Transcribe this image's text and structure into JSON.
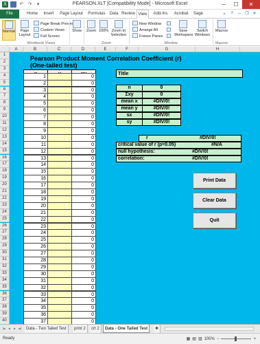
{
  "window": {
    "title": "PEARSON.XLT  [Compatibility Mode]  -  Microsoft Excel"
  },
  "tabs": [
    "File",
    "Home",
    "Insert",
    "Page Layout",
    "Formulas",
    "Data",
    "Review",
    "View",
    "Add-Ins",
    "Acrobat",
    "Sage"
  ],
  "active_tab": "View",
  "ribbon": {
    "normal": "Normal",
    "page_layout": "Page Layout",
    "page_break_preview": "Page Break Preview",
    "custom_views": "Custom Views",
    "full_screen": "Full Screen",
    "workbook_views_group": "Workbook Views",
    "show": "Show",
    "zoom": "Zoom",
    "zoom_100": "100%",
    "zoom_to_selection": "Zoom to Selection",
    "zoom_group": "Zoom",
    "new_window": "New Window",
    "arrange_all": "Arrange All",
    "freeze_panes": "Freeze Panes",
    "save_workspace": "Save Workspace",
    "switch_windows": "Switch Windows",
    "window_group": "Window",
    "macros": "Macros",
    "macros_group": "Macros"
  },
  "columns": [
    "A",
    "B",
    "C",
    "D",
    "E",
    "F",
    "G",
    "H"
  ],
  "sheet": {
    "title_line1": "Pearson Product Moment Correlation Coefficient (r)",
    "title_line2": "(One-tailed test)",
    "headers": [
      "x",
      "y",
      "xy"
    ],
    "indices": [
      "1",
      "2",
      "3",
      "4",
      "5",
      "6",
      "7",
      "8",
      "9",
      "10",
      "11",
      "12",
      "13",
      "14",
      "15",
      "16",
      "17",
      "18",
      "19",
      "20",
      "21",
      "22",
      "23",
      "24",
      "25",
      "26",
      "27",
      "28",
      "29",
      "30",
      "31",
      "32",
      "33",
      "34",
      "35",
      "36",
      "37"
    ],
    "xy_value": "0",
    "title_box": "Title",
    "stats": [
      {
        "label": "n",
        "value": "0"
      },
      {
        "label": "Σxy",
        "value": "0"
      },
      {
        "label": "mean x",
        "value": "#DIV/0!"
      },
      {
        "label": "mean y",
        "value": "#DIV/0!"
      },
      {
        "label": "sx",
        "value": "#DIV/0!"
      },
      {
        "label": "sy",
        "value": "#DIV/0!"
      }
    ],
    "r_label": "r",
    "r_value": "#DIV/0!",
    "critical_label": "critical value of r (p=0.05)",
    "critical_value": "#N/A",
    "null_label": "null hypothesis:",
    "null_value": "#DIV/0!",
    "correlation_label": "correlation:",
    "correlation_value": "#DIV/0!",
    "buttons": [
      "Print Data",
      "Clear Data",
      "Quit"
    ]
  },
  "sheet_tabs": [
    "Data - Two Tailed Test",
    "print 2",
    "crt 2",
    "Data - One Tailed Test"
  ],
  "active_sheet": "Data - One Tailed Test",
  "status": {
    "ready": "Ready",
    "zoom": "100%"
  },
  "colors": {
    "sheet_background": "#00b7eb",
    "stats_fill": "#c6efce",
    "input_fill": "#ffffc0",
    "excel_green": "#1e7145"
  }
}
